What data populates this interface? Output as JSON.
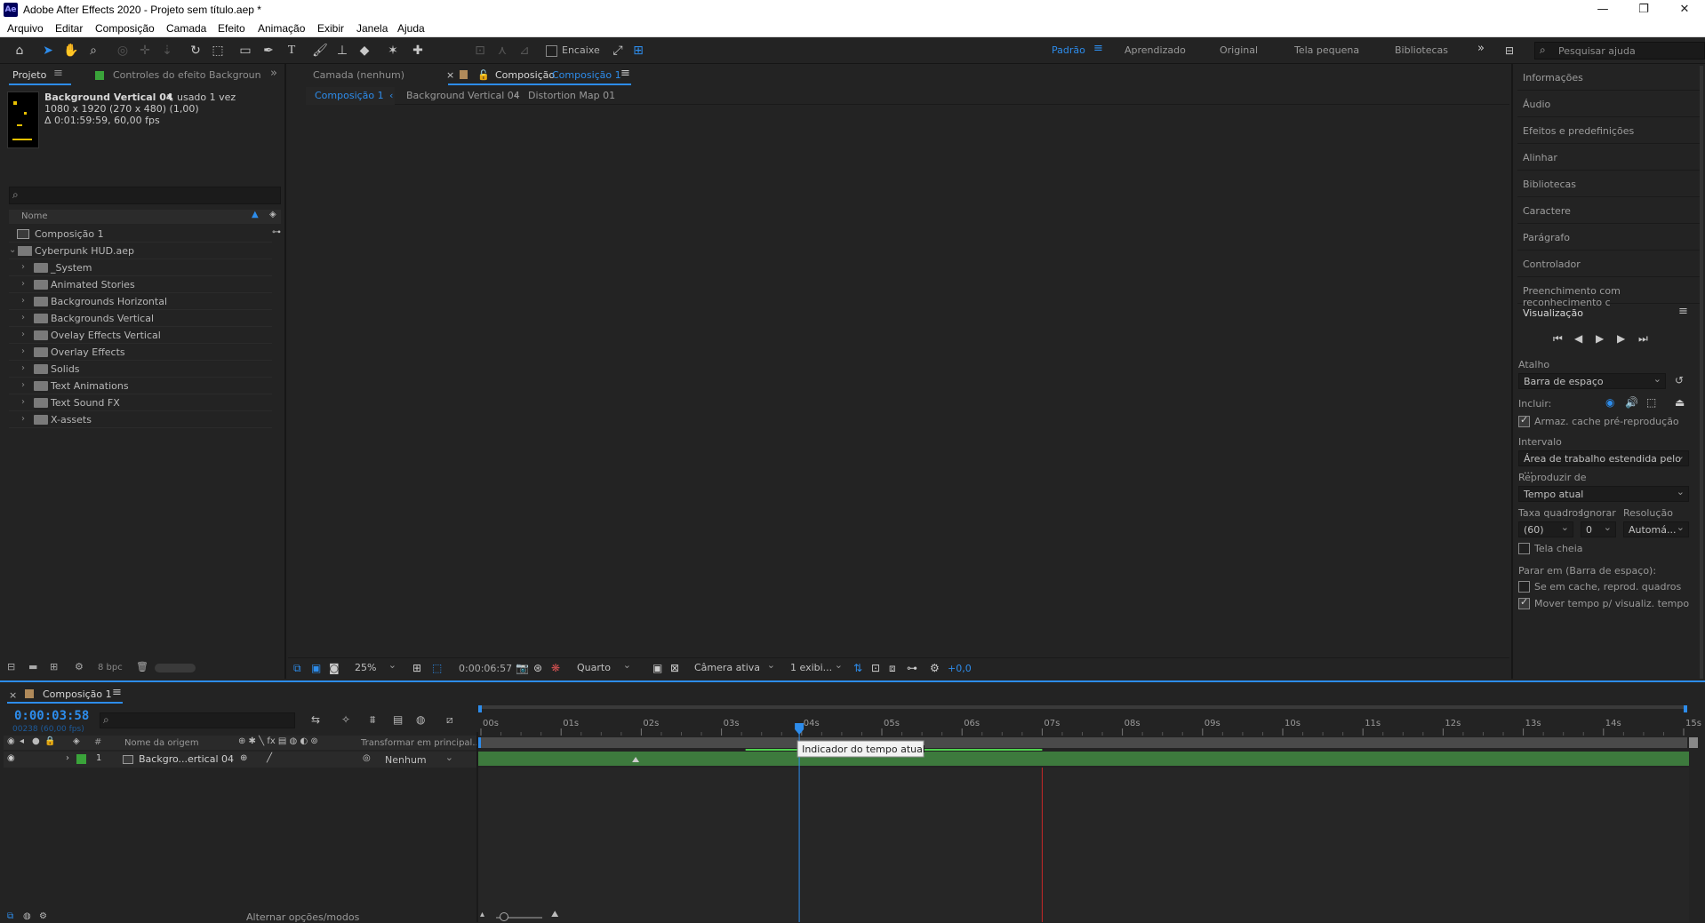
{
  "window": {
    "app_icon": "Ae",
    "title": "Adobe After Effects 2020 - Projeto sem título.aep *",
    "controls": [
      "—",
      "❐",
      "✕"
    ]
  },
  "menu": [
    "Arquivo",
    "Editar",
    "Composição",
    "Camada",
    "Efeito",
    "Animação",
    "Exibir",
    "Janela",
    "Ajuda"
  ],
  "toolbar": {
    "snap_label": "Encaixe",
    "workspaces": [
      "Padrão",
      "Aprendizado",
      "Original",
      "Tela pequena",
      "Bibliotecas"
    ],
    "active_workspace": "Padrão",
    "more": "»",
    "help_search_placeholder": "Pesquisar ajuda"
  },
  "project_panel": {
    "tab_project": "Projeto",
    "tab_effects": "Controles do efeito  Backgroun",
    "asset_name": "Background Vertical 04",
    "asset_used": ", usado 1 vez",
    "asset_dims": "1080 x 1920  (270 x 480) (1,00)",
    "asset_duration": "Δ 0:01:59:59, 60,00 fps",
    "column_name": "Nome",
    "items": [
      {
        "name": "Composição 1",
        "type": "comp",
        "indent": 0
      },
      {
        "name": "Cyberpunk HUD.aep",
        "type": "project",
        "indent": 0,
        "expanded": true
      },
      {
        "name": "_System",
        "type": "folder"
      },
      {
        "name": "Animated Stories",
        "type": "folder"
      },
      {
        "name": "Backgrounds Horizontal",
        "type": "folder"
      },
      {
        "name": "Backgrounds Vertical",
        "type": "folder"
      },
      {
        "name": "Ovelay Effects Vertical",
        "type": "folder"
      },
      {
        "name": "Overlay Effects",
        "type": "folder"
      },
      {
        "name": "Solids",
        "type": "folder"
      },
      {
        "name": "Text Animations",
        "type": "folder"
      },
      {
        "name": "Text Sound FX",
        "type": "folder"
      },
      {
        "name": "X-assets",
        "type": "folder"
      }
    ],
    "bpc": "8 bpc"
  },
  "viewer": {
    "tab_layer": "Camada (nenhum)",
    "tab_comp_prefix": "Composição",
    "tab_comp_name": "Composição 1",
    "breadcrumbs": [
      "Composição 1",
      "Background Vertical 04",
      "Distortion Map 01"
    ],
    "zoom": "25%",
    "timecode": "0:00:06:57",
    "resolution": "Quarto",
    "camera": "Câmera ativa",
    "views": "1 exibi...",
    "exposure": "+0,0"
  },
  "right_panel": {
    "items": [
      "Informações",
      "Áudio",
      "Efeitos e predefinições",
      "Alinhar",
      "Bibliotecas",
      "Caractere",
      "Parágrafo",
      "Controlador",
      "Preenchimento com reconhecimento c"
    ],
    "preview": {
      "title": "Visualização",
      "shortcut_label": "Atalho",
      "shortcut_value": "Barra de espaço",
      "include_label": "Incluir:",
      "cache_label": "Armaz. cache pré-reprodução",
      "interval_label": "Intervalo",
      "interval_value": "Área de trabalho estendida pelo ...",
      "play_from_label": "Reproduzir de",
      "play_from_value": "Tempo atual",
      "frame_rate_label": "Taxa quadros",
      "skip_label": "Ignorar",
      "resolution_label": "Resolução",
      "frame_rate_value": "(60)",
      "skip_value": "0",
      "resolution_value": "Automá...",
      "fullscreen_label": "Tela cheia",
      "stop_label": "Parar em (Barra de espaço):",
      "cached_label": "Se em cache, reprod. quadros",
      "move_time_label": "Mover tempo p/ visualiz. tempo"
    }
  },
  "timeline": {
    "tab": "Composição 1",
    "timecode": "0:00:03:58",
    "frames": "00238 (60,00 fps)",
    "col_source": "Nome da origem",
    "col_parent": "Transformar em principal...",
    "layer_index": "1",
    "layer_name": "Backgro...ertical 04",
    "parent_value": "Nenhum",
    "ticks": [
      "00s",
      "01s",
      "02s",
      "03s",
      "04s",
      "05s",
      "06s",
      "07s",
      "08s",
      "09s",
      "10s",
      "11s",
      "12s",
      "13s",
      "14s",
      "15s"
    ],
    "tooltip": "Indicador do tempo atual",
    "toggle_label": "Alternar opções/modos",
    "current_time_s": 3.97,
    "work_end_s": 7.0
  },
  "colors": {
    "accent": "#2d8ceb",
    "layer_bar": "#3d7a3d",
    "label_green": "#3aa33a",
    "work_end": "#c82828"
  }
}
